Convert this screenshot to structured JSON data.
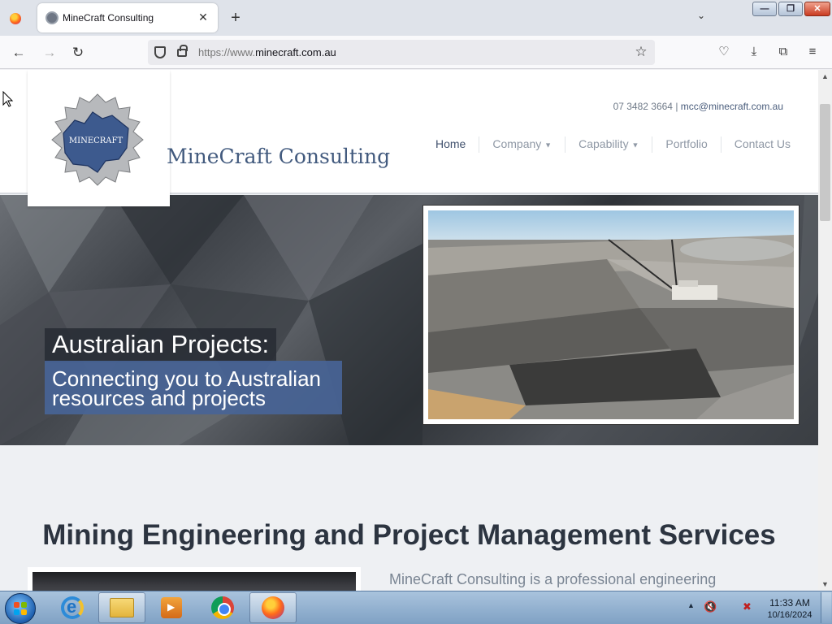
{
  "browser": {
    "tab": {
      "title": "MineCraft Consulting",
      "close": "✕"
    },
    "new_tab": "+",
    "tab_list": "⌄",
    "url": {
      "scheme": "https://www.",
      "host": "minecraft.com.au"
    },
    "window_controls": {
      "minimize": "—",
      "maximize": "❐",
      "close": "✕"
    },
    "nav": {
      "back": "←",
      "forward": "→",
      "reload": "↻"
    },
    "tools": {
      "star": "☆",
      "pocket": "♡",
      "downloads": "⤓",
      "extensions": "⧉",
      "menu": "≡"
    }
  },
  "site": {
    "logo_text": "MINECRAFT",
    "brand_name": "MineCraft Consulting",
    "contact": {
      "phone": "07 3482 3664",
      "separator": " | ",
      "email": "mcc@minecraft.com.au"
    },
    "nav": [
      {
        "label": "Home",
        "active": true,
        "dropdown": false
      },
      {
        "label": "Company",
        "active": false,
        "dropdown": true
      },
      {
        "label": "Capability",
        "active": false,
        "dropdown": true
      },
      {
        "label": "Portfolio",
        "active": false,
        "dropdown": false
      },
      {
        "label": "Contact Us",
        "active": false,
        "dropdown": false
      }
    ],
    "hero": {
      "title": "Australian Projects:",
      "subtitle": "Connecting you to Australian resources and projects"
    },
    "services": {
      "title": "Mining Engineering and Project Management Services",
      "intro": "MineCraft Consulting is a professional engineering"
    }
  },
  "taskbar": {
    "clock": {
      "time": "11:33 AM",
      "date": "10/16/2024"
    },
    "tray_arrow": "▲",
    "items": [
      "Internet Explorer",
      "Windows Explorer",
      "Windows Media Player",
      "Google Chrome",
      "Firefox"
    ]
  },
  "colors": {
    "brand_blue": "#425a7e",
    "hero_subtitle_bg": "#4864a0",
    "nav_active": "#42526e"
  }
}
